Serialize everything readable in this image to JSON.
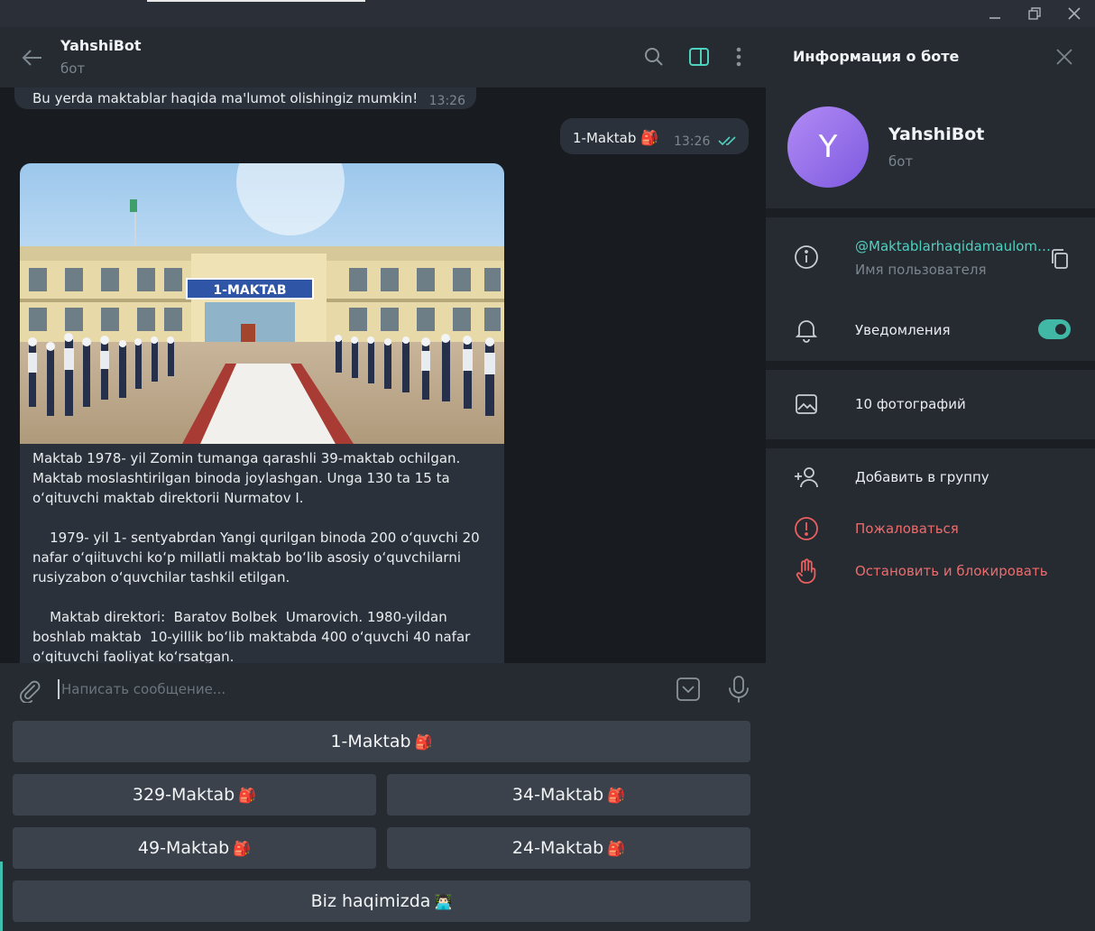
{
  "chat": {
    "title": "YahshiBot",
    "subtitle": "бот",
    "messages": {
      "top_incoming": {
        "text": "Bu yerda maktablar haqida ma'lumot olishingiz mumkin!",
        "time": "13:26"
      },
      "outgoing": {
        "text": "1-Maktab",
        "emoji": "🎒",
        "time": "13:26"
      },
      "photo_caption": {
        "paragraphs": [
          "Maktab 1978- yil Zomin tumanga qarashli 39-maktab ochilgan. Maktab moslashtirilgan binoda joylashgan. Unga 130 ta 15 ta oʻqituvchi maktab direktorii Nurmatov I.",
          "    1979- yil 1- sentyabrdan Yangi qurilgan binoda 200 oʻquvchi 20 nafar oʻqiituvchi koʻp millatli maktab boʻlib asosiy oʻquvchilarni rusiyzabon oʻquvchilar tashkil etilgan.",
          "    Maktab direktori:  Baratov Bolbek  Umarovich. 1980-yildan boshlab maktab  10-yillik boʻlib maktabda 400 oʻquvchi 40 nafar oʻqituvchi faoliyat koʻrsatgan."
        ],
        "photo_sign": "1-MAKTAB"
      }
    },
    "input": {
      "placeholder": "Написать сообщение..."
    },
    "keyboard": {
      "row1": {
        "label": "1-Maktab",
        "emoji": "🎒"
      },
      "row2": [
        {
          "label": "329-Maktab",
          "emoji": "🎒"
        },
        {
          "label": "34-Maktab",
          "emoji": "🎒"
        }
      ],
      "row3": [
        {
          "label": "49-Maktab",
          "emoji": "🎒"
        },
        {
          "label": "24-Maktab",
          "emoji": "🎒"
        }
      ],
      "row4": {
        "label": "Biz haqimizda",
        "emoji": "👨🏻‍💻"
      }
    }
  },
  "panel": {
    "title": "Информация о боте",
    "avatar_letter": "Y",
    "bot_name": "YahshiBot",
    "bot_sub": "бот",
    "username": "@Maktablarhaqidamaulomot_bot",
    "username_label": "Имя пользователя",
    "notifications": "Уведомления",
    "notifications_on": true,
    "photos": "10 фотографий",
    "add_to_group": "Добавить в группу",
    "report": "Пожаловаться",
    "block": "Остановить и блокировать"
  },
  "colors": {
    "accent": "#4fd1c0",
    "danger": "#ec6c6c",
    "avatar_from": "#b28bf5",
    "avatar_to": "#7d5ae0"
  }
}
